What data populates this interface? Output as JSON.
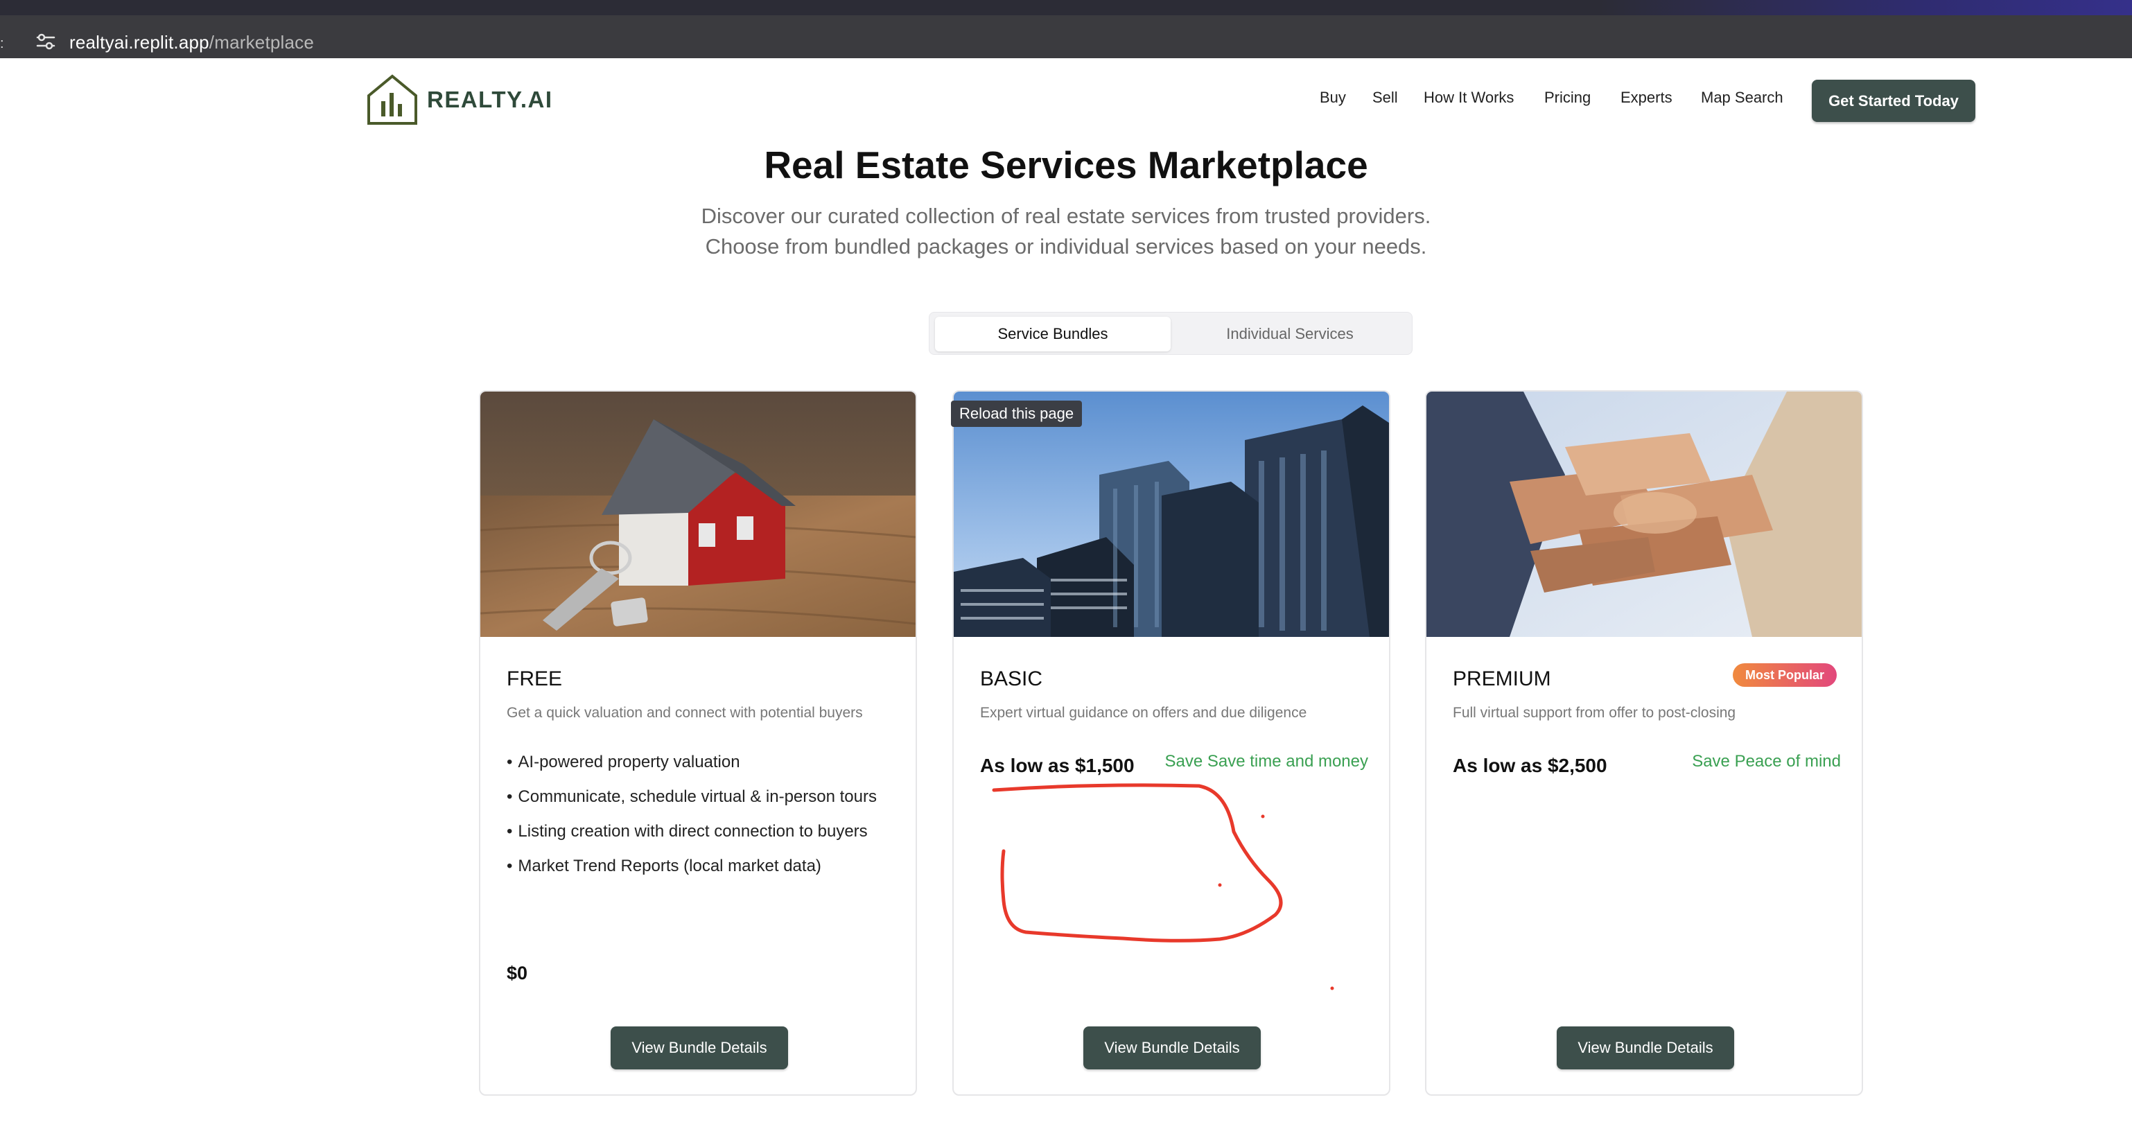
{
  "browser": {
    "url_host": "realtyai.replit.app",
    "url_path": "/marketplace"
  },
  "header": {
    "logo_text": "REALTY.AI",
    "nav": [
      "Buy",
      "Sell",
      "How It Works",
      "Pricing",
      "Experts",
      "Map Search"
    ],
    "cta_label": "Get Started Today"
  },
  "hero": {
    "title": "Real Estate Services Marketplace",
    "subtitle_line1": "Discover our curated collection of real estate services from trusted providers.",
    "subtitle_line2": "Choose from bundled packages or individual services based on your needs."
  },
  "tabs": {
    "active": "Service Bundles",
    "inactive": "Individual Services"
  },
  "tooltip": "Reload this page",
  "cards": [
    {
      "title": "FREE",
      "description": "Get a quick valuation and connect with potential buyers",
      "features": [
        "AI-powered property valuation",
        "Communicate, schedule virtual & in-person tours",
        "Listing creation with direct connection to buyers",
        "Market Trend Reports (local market data)"
      ],
      "price": "$0",
      "button": "View Bundle Details",
      "image": "house-model-with-keys"
    },
    {
      "title": "BASIC",
      "description": "Expert virtual guidance on offers and due diligence",
      "price": "As low as $1,500",
      "save": "Save Save time and money",
      "button": "View Bundle Details",
      "image": "city-skyscrapers"
    },
    {
      "title": "PREMIUM",
      "badge": "Most Popular",
      "description": "Full virtual support from offer to post-closing",
      "price": "As low as $2,500",
      "save": "Save Peace of mind",
      "button": "View Bundle Details",
      "image": "stacked-hands-teamwork"
    }
  ],
  "colors": {
    "primary_button": "#3d4f4b",
    "logo_green": "#4a5a2a",
    "save_green": "#3aa052",
    "annotation_red": "#e8392b"
  }
}
